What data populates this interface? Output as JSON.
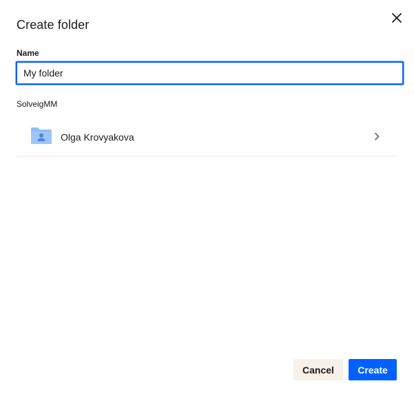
{
  "dialog": {
    "title": "Create folder",
    "close_icon": "close-icon"
  },
  "name_field": {
    "label": "Name",
    "value": "My folder"
  },
  "location": {
    "label": "SolveigMM",
    "items": [
      {
        "name": "Olga Krovyakova",
        "icon": "shared-folder-icon",
        "trailing_icon": "chevron-right-icon"
      }
    ]
  },
  "actions": {
    "cancel_label": "Cancel",
    "create_label": "Create"
  },
  "colors": {
    "accent": "#0061fe",
    "cancel_bg": "#f7f1ea",
    "folder": "#8fbff7",
    "text": "#1e1919"
  }
}
